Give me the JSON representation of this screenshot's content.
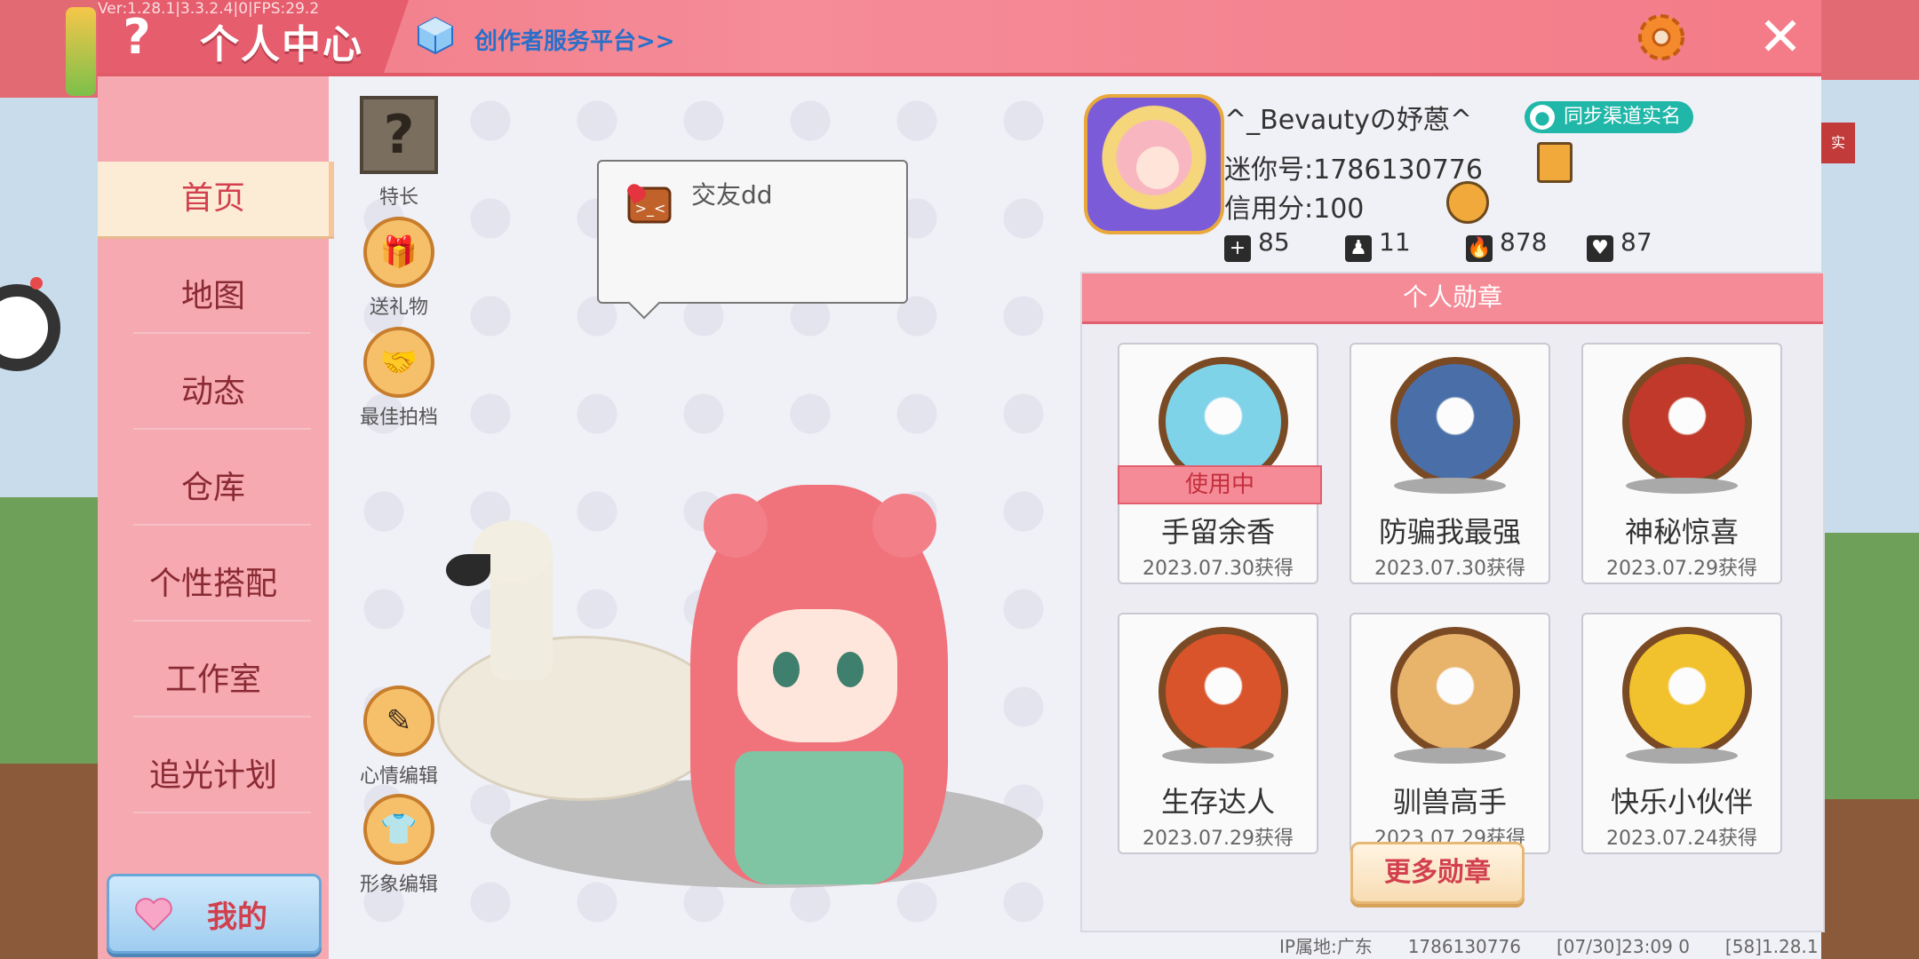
{
  "header": {
    "version_text": "Ver:1.28.1|3.3.2.4|0|FPS:29.2",
    "title": "个人中心",
    "creator_link": "创作者服务平台>>",
    "help_label": "?"
  },
  "sidebar": {
    "items": [
      {
        "label": "首页",
        "active": true
      },
      {
        "label": "地图"
      },
      {
        "label": "动态"
      },
      {
        "label": "仓库"
      },
      {
        "label": "个性搭配"
      },
      {
        "label": "工作室"
      },
      {
        "label": "追光计划"
      }
    ],
    "mine_label": "我的"
  },
  "stage": {
    "side_buttons": [
      {
        "label": "特长",
        "icon": "question-block-icon"
      },
      {
        "label": "送礼物",
        "icon": "gift-icon"
      },
      {
        "label": "最佳拍档",
        "icon": "handshake-icon"
      },
      {
        "label": "心情编辑",
        "icon": "pencil-icon"
      },
      {
        "label": "形象编辑",
        "icon": "outfit-icon"
      }
    ],
    "bubble_text": "交友dd"
  },
  "profile": {
    "username": "^_Bevautyの妤蒽^",
    "sync_label": "同步渠道实名",
    "mini_id": "迷你号:1786130776",
    "credit": "信用分:100",
    "stats": [
      {
        "icon": "plus-icon",
        "value": "85"
      },
      {
        "icon": "fans-icon",
        "value": "11"
      },
      {
        "icon": "flame-icon",
        "value": "878"
      },
      {
        "icon": "heart-icon",
        "value": "87"
      }
    ]
  },
  "medals": {
    "title": "个人勋章",
    "in_use_label": "使用中",
    "more_label": "更多勋章",
    "items": [
      {
        "name": "手留余香",
        "date": "2023.07.30获得",
        "in_use": true,
        "color": "#7fd3e8"
      },
      {
        "name": "防骗我最强",
        "date": "2023.07.30获得",
        "color": "#4a6fa8"
      },
      {
        "name": "神秘惊喜",
        "date": "2023.07.29获得",
        "color": "#c0392b"
      },
      {
        "name": "生存达人",
        "date": "2023.07.29获得",
        "color": "#d9542b"
      },
      {
        "name": "驯兽高手",
        "date": "2023.07.29获得",
        "color": "#e8b36a"
      },
      {
        "name": "快乐小伙伴",
        "date": "2023.07.24获得",
        "color": "#f2c12e"
      }
    ]
  },
  "footer": {
    "ip": "IP属地:广东",
    "uid": "1786130776",
    "time": "[07/30]23:09 0",
    "build": "[58]1.28.1"
  }
}
